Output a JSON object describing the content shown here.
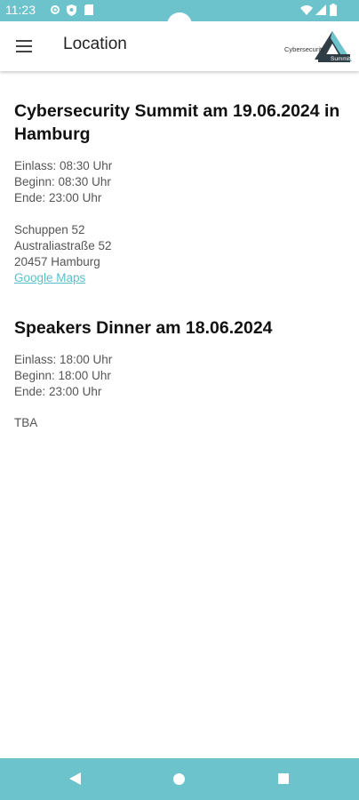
{
  "status_bar": {
    "time": "11:23"
  },
  "app_bar": {
    "title": "Location",
    "logo_line1": "Cybersecurity",
    "logo_line2": "Summit"
  },
  "events": [
    {
      "title": "Cybersecurity Summit am 19.06.2024 in Hamburg",
      "details": [
        "Einlass: 08:30 Uhr",
        "Beginn: 08:30 Uhr",
        "Ende: 23:00 Uhr"
      ],
      "address": [
        "Schuppen 52",
        "Australiastraße 52",
        "20457 Hamburg"
      ],
      "maps_link": "Google Maps"
    },
    {
      "title": "Speakers Dinner am 18.06.2024",
      "details": [
        "Einlass: 18:00 Uhr",
        "Beginn: 18:00 Uhr",
        "Ende: 23:00 Uhr"
      ],
      "note": "TBA"
    }
  ],
  "colors": {
    "accent": "#6cc3cc",
    "link": "#5bbfc9",
    "text": "#222222",
    "muted": "#555555"
  }
}
